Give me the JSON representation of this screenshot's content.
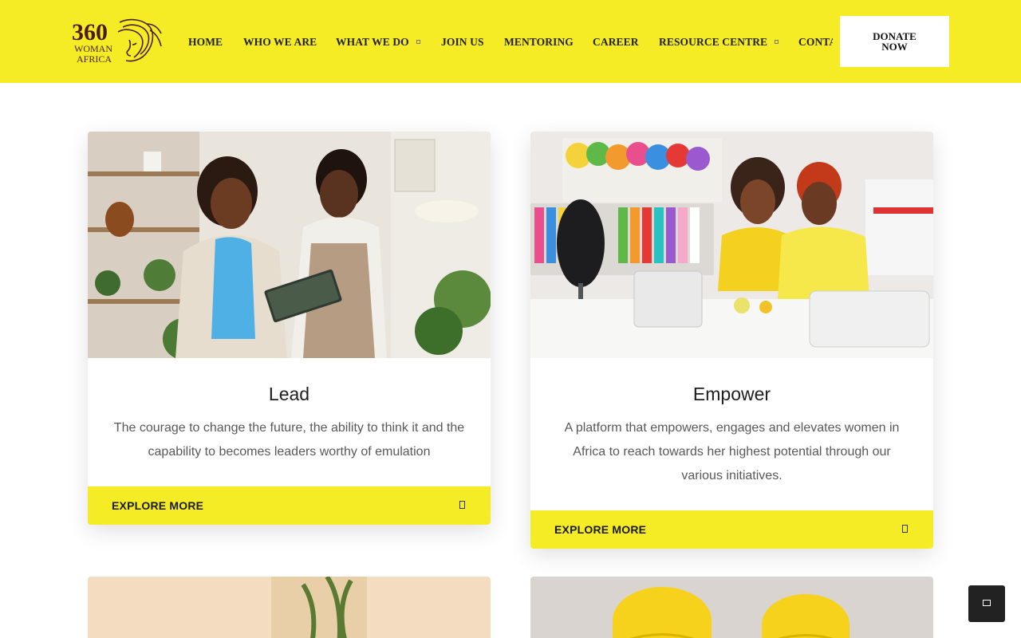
{
  "brand": {
    "logo_text_top": "360",
    "logo_text_mid": "WOMAN",
    "logo_text_bottom": "AFRICA",
    "logo_color": "#4a1f0f"
  },
  "colors": {
    "accent_yellow": "#f6ec25",
    "text_dark": "#1e1e1e",
    "text_body": "#585858"
  },
  "nav": {
    "items": [
      {
        "label": "HOME",
        "has_dropdown": false
      },
      {
        "label": "WHO WE ARE",
        "has_dropdown": false
      },
      {
        "label": "WHAT WE DO",
        "has_dropdown": true
      },
      {
        "label": "JOIN US",
        "has_dropdown": false
      },
      {
        "label": "MENTORING",
        "has_dropdown": false
      },
      {
        "label": "CAREER",
        "has_dropdown": false
      },
      {
        "label": "RESOURCE CENTRE",
        "has_dropdown": true
      },
      {
        "label": "CONTACT",
        "has_dropdown": false
      }
    ],
    "donate_label": "DONATE NOW"
  },
  "cards": [
    {
      "title": "Lead",
      "text": "The courage to change the future, the ability to think it and the capability to becomes leaders worthy of emulation",
      "button_label": "EXPLORE MORE",
      "button_icon": "arrow-square-icon",
      "image_icon": "women-with-tablet-photo"
    },
    {
      "title": "Empower",
      "text": "A platform that empowers, engages and elevates women in Africa to reach towards her highest potential through our various initiatives.",
      "button_label": "EXPLORE MORE",
      "button_icon": "arrow-square-icon",
      "image_icon": "women-sewing-studio-photo"
    }
  ],
  "floating": {
    "icon": "chat-square-icon"
  }
}
